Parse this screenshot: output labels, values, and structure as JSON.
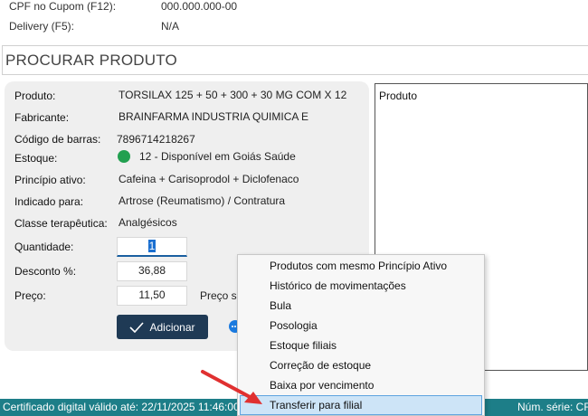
{
  "header": {
    "cpf_label": "CPF no Cupom (F12):",
    "cpf_value": "000.000.000-00",
    "delivery_label": "Delivery (F5):",
    "delivery_value": "N/A"
  },
  "search": {
    "title": "PROCURAR PRODUTO"
  },
  "product": {
    "produto_label": "Produto:",
    "produto_value": "TORSILAX 125 + 50 + 300 + 30 MG COM X 12",
    "fabricante_label": "Fabricante:",
    "fabricante_value": "BRAINFARMA INDUSTRIA QUIMICA E",
    "codigo_label": "Código de barras:",
    "codigo_value": "7896714218267",
    "estoque_label": "Estoque:",
    "estoque_value": "12 - Disponível em Goiás Saúde",
    "estoque_color": "#22a050",
    "principio_label": "Princípio ativo:",
    "principio_value": "Cafeina + Carisoprodol + Diclofenaco",
    "indicado_label": "Indicado para:",
    "indicado_value": "Artrose (Reumatismo) / Contratura",
    "classe_label": "Classe terapêutica:",
    "classe_value": "Analgésicos",
    "quantidade_label": "Quantidade:",
    "quantidade_value": "1",
    "desconto_label": "Desconto %:",
    "desconto_value": "36,88",
    "preco_label": "Preço:",
    "preco_value": "11,50",
    "preco_extra": "Preço su",
    "add_label": "Adicionar"
  },
  "results": {
    "header": "Produto"
  },
  "context_menu": {
    "items": [
      "Produtos com mesmo Princípio Ativo",
      "Histórico de movimentações",
      "Bula",
      "Posologia",
      "Estoque filiais",
      "Correção de estoque",
      "Baixa por vencimento",
      "Transferir para filial"
    ],
    "highlighted": "Transferir para filial"
  },
  "status_bar": {
    "certificate": "Certificado digital válido até: 22/11/2025 11:46:00",
    "serial": "Núm. série: CR"
  },
  "colors": {
    "status_bar": "#1d7e88",
    "add_button": "#1f3a55",
    "menu_highlight": "#cde4f7",
    "arrow": "#e03030"
  }
}
